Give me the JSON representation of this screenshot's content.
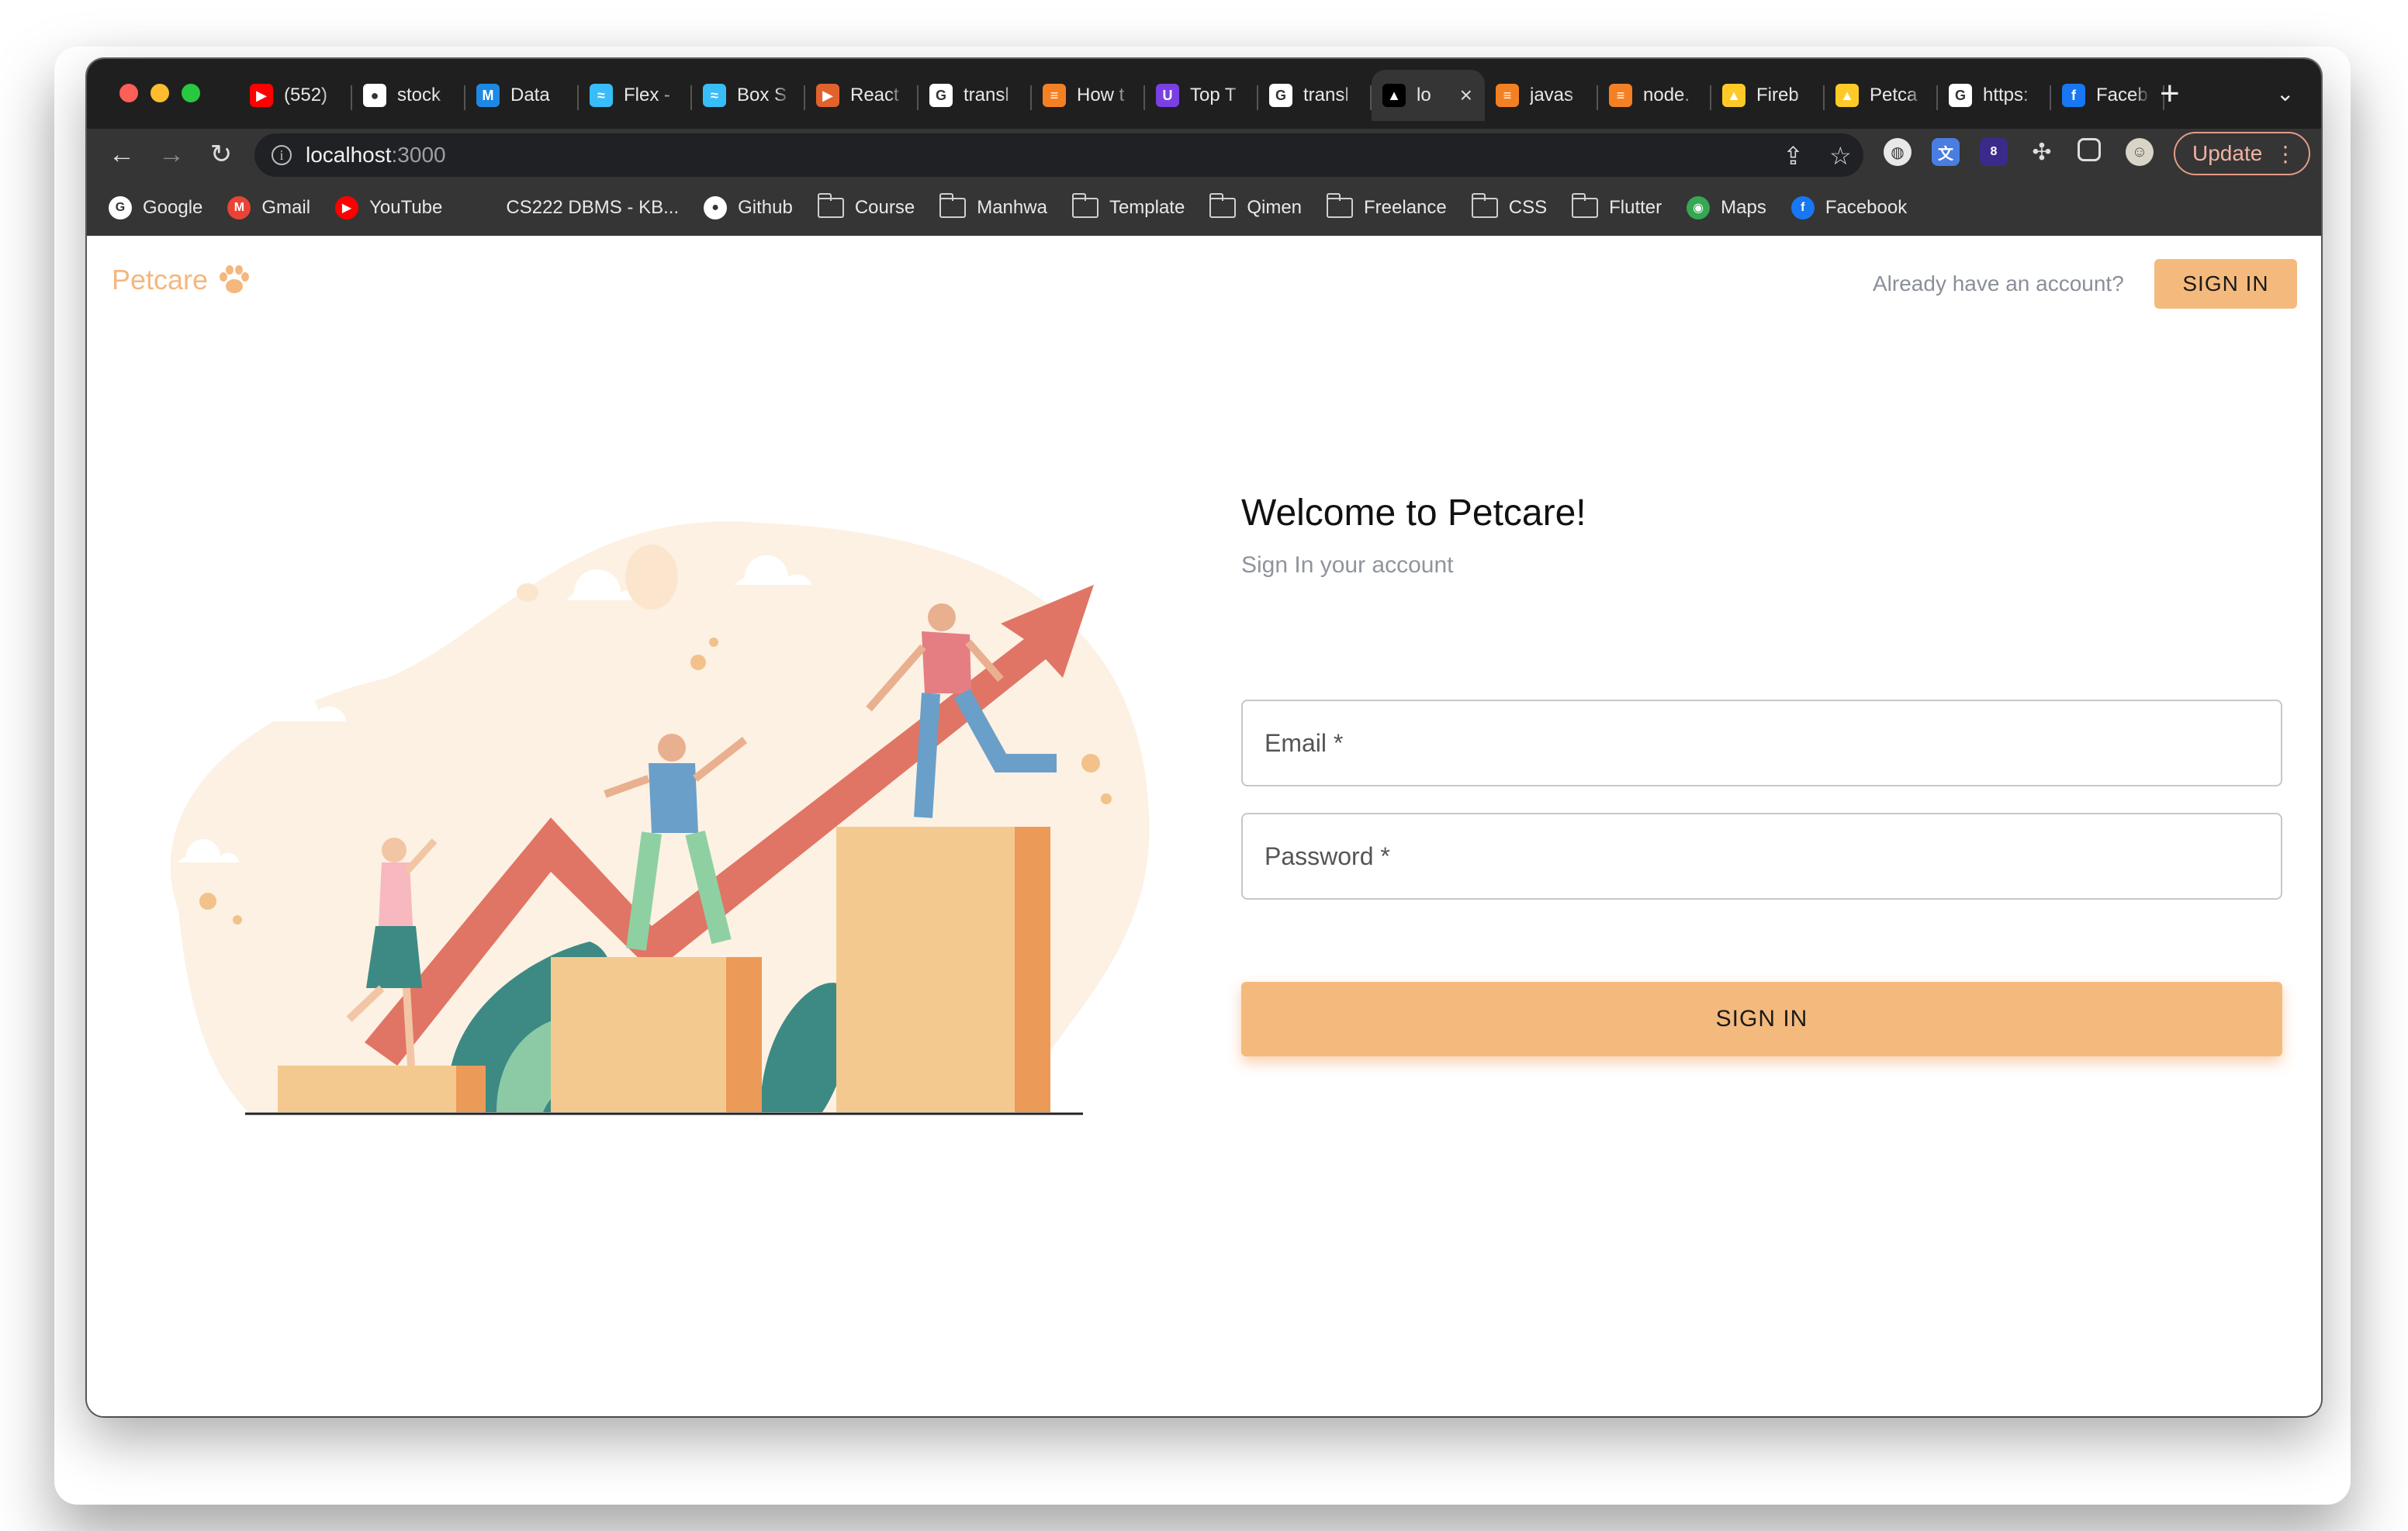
{
  "browser": {
    "tabs": [
      {
        "title": "(552)",
        "favicon": "youtube-icon",
        "color": "#ff0000",
        "glyph": "▶"
      },
      {
        "title": "stock",
        "favicon": "github-icon",
        "color": "#ffffff",
        "glyph": "●"
      },
      {
        "title": "Data",
        "favicon": "mui-icon",
        "color": "#1e88e5",
        "glyph": "M"
      },
      {
        "title": "Flex -",
        "favicon": "tailwind-icon",
        "color": "#38bdf8",
        "glyph": "≈"
      },
      {
        "title": "Box S",
        "favicon": "tailwind-icon",
        "color": "#38bdf8",
        "glyph": "≈"
      },
      {
        "title": "React",
        "favicon": "play-icon",
        "color": "#e2622c",
        "glyph": "▶"
      },
      {
        "title": "transl",
        "favicon": "google-icon",
        "color": "#ffffff",
        "glyph": "G"
      },
      {
        "title": "How t",
        "favicon": "stackoverflow-icon",
        "color": "#f48024",
        "glyph": "≡"
      },
      {
        "title": "Top T",
        "favicon": "udemy-icon",
        "color": "#7b3fe4",
        "glyph": "U"
      },
      {
        "title": "transl",
        "favicon": "google-icon",
        "color": "#ffffff",
        "glyph": "G"
      },
      {
        "title": "lo",
        "favicon": "nextjs-icon",
        "color": "#000000",
        "glyph": "▲",
        "active": true
      },
      {
        "title": "javas",
        "favicon": "stackoverflow-icon",
        "color": "#f48024",
        "glyph": "≡"
      },
      {
        "title": "node.",
        "favicon": "stackoverflow-icon",
        "color": "#f48024",
        "glyph": "≡"
      },
      {
        "title": "Fireb",
        "favicon": "firebase-icon",
        "color": "#ffca28",
        "glyph": "▲"
      },
      {
        "title": "Petca",
        "favicon": "firebase-icon",
        "color": "#ffca28",
        "glyph": "▲"
      },
      {
        "title": "https:",
        "favicon": "google-icon",
        "color": "#ffffff",
        "glyph": "G"
      },
      {
        "title": "Faceb",
        "favicon": "facebook-icon",
        "color": "#1877f2",
        "glyph": "f"
      }
    ],
    "url_host": "localhost",
    "url_port": ":3000",
    "update_label": "Update",
    "extension_badge": "8",
    "bookmarks": [
      {
        "label": "Google",
        "icon": "google-icon",
        "color": "#ffffff",
        "glyph": "G"
      },
      {
        "label": "Gmail",
        "icon": "gmail-icon",
        "color": "#ea4335",
        "glyph": "M"
      },
      {
        "label": "YouTube",
        "icon": "youtube-icon",
        "color": "#ff0000",
        "glyph": "▶"
      },
      {
        "label": "CS222 DBMS - KB...",
        "icon": "none"
      },
      {
        "label": "Github",
        "icon": "github-icon",
        "color": "#ffffff",
        "glyph": "●"
      },
      {
        "label": "Course",
        "icon": "folder-icon"
      },
      {
        "label": "Manhwa",
        "icon": "folder-icon"
      },
      {
        "label": "Template",
        "icon": "folder-icon"
      },
      {
        "label": "Qimen",
        "icon": "folder-icon"
      },
      {
        "label": "Freelance",
        "icon": "folder-icon"
      },
      {
        "label": "CSS",
        "icon": "folder-icon"
      },
      {
        "label": "Flutter",
        "icon": "folder-icon"
      },
      {
        "label": "Maps",
        "icon": "maps-icon",
        "color": "#34a853",
        "glyph": "◉"
      },
      {
        "label": "Facebook",
        "icon": "facebook-icon",
        "color": "#1877f2",
        "glyph": "f"
      }
    ]
  },
  "app": {
    "brand": "Petcare",
    "already_text": "Already have an account?",
    "top_signin_label": "SIGN IN",
    "welcome_title": "Welcome to Petcare!",
    "subtitle": "Sign In your account",
    "email_label": "Email *",
    "password_label": "Password *",
    "main_signin_label": "SIGN IN",
    "colors": {
      "accent": "#f4ba7d",
      "brand_text": "#f4b77d"
    }
  }
}
